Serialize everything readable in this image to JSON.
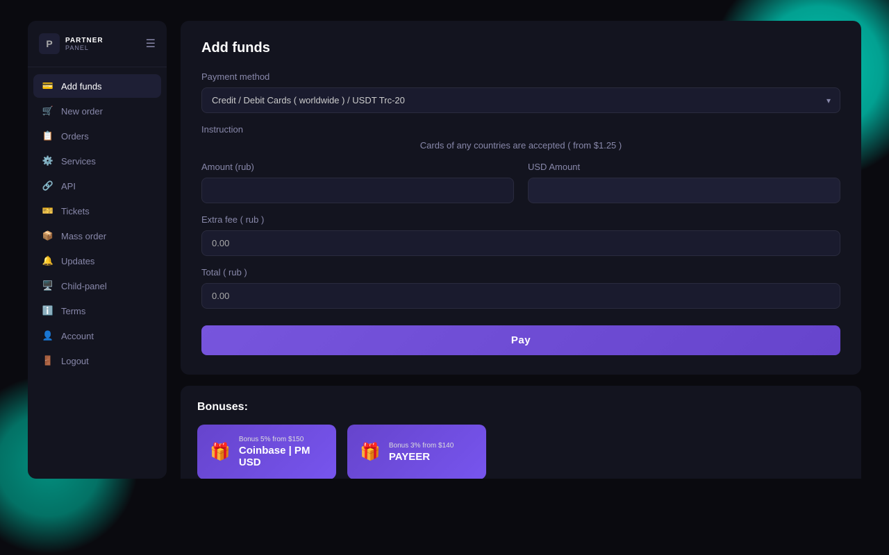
{
  "app": {
    "logo_letter": "P",
    "logo_partner": "PARTNER",
    "logo_panel": "PANEL"
  },
  "sidebar": {
    "items": [
      {
        "id": "add-funds",
        "label": "Add funds",
        "icon": "💳",
        "active": true
      },
      {
        "id": "new-order",
        "label": "New order",
        "icon": "🛒",
        "active": false
      },
      {
        "id": "orders",
        "label": "Orders",
        "icon": "📋",
        "active": false
      },
      {
        "id": "services",
        "label": "Services",
        "icon": "⚙️",
        "active": false
      },
      {
        "id": "api",
        "label": "API",
        "icon": "🔗",
        "active": false
      },
      {
        "id": "tickets",
        "label": "Tickets",
        "icon": "🎫",
        "active": false
      },
      {
        "id": "mass-order",
        "label": "Mass order",
        "icon": "📦",
        "active": false
      },
      {
        "id": "updates",
        "label": "Updates",
        "icon": "🔔",
        "active": false
      },
      {
        "id": "child-panel",
        "label": "Child-panel",
        "icon": "🖥️",
        "active": false
      },
      {
        "id": "terms",
        "label": "Terms",
        "icon": "ℹ️",
        "active": false
      },
      {
        "id": "account",
        "label": "Account",
        "icon": "👤",
        "active": false
      },
      {
        "id": "logout",
        "label": "Logout",
        "icon": "🚪",
        "active": false
      }
    ]
  },
  "main": {
    "page_title": "Add funds",
    "payment_method": {
      "label": "Payment method",
      "value": "Credit / Debit Cards ( worldwide ) / USDT Trc-20",
      "options": [
        "Credit / Debit Cards ( worldwide ) / USDT Trc-20"
      ]
    },
    "instruction": {
      "label": "Instruction",
      "text": "Cards of any countries are accepted ( from $1.25 )"
    },
    "amount_rub": {
      "label": "Amount (rub)",
      "placeholder": "",
      "value": ""
    },
    "usd_amount": {
      "label": "USD Amount",
      "placeholder": "",
      "value": ""
    },
    "extra_fee": {
      "label": "Extra fee ( rub )",
      "value": "0.00"
    },
    "total": {
      "label": "Total ( rub )",
      "value": "0.00"
    },
    "pay_button": "Pay"
  },
  "bonuses": {
    "title": "Bonuses:",
    "items": [
      {
        "id": "coinbase",
        "sub_label": "Bonus 5% from $150",
        "name": "Coinbase | PM USD",
        "icon": "🎁"
      },
      {
        "id": "payeer",
        "sub_label": "Bonus 3% from $140",
        "name": "PAYEER",
        "icon": "🎁"
      }
    ]
  }
}
